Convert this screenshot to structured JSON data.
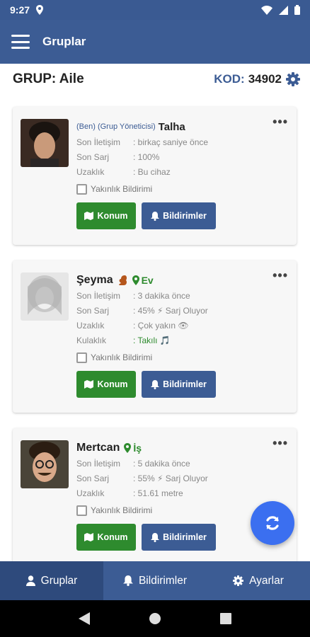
{
  "status_bar": {
    "time": "9:27"
  },
  "app_bar": {
    "title": "Gruplar"
  },
  "group": {
    "name": "GRUP: Aile",
    "code_label": "KOD:",
    "code_value": "34902"
  },
  "labels": {
    "last_contact": "Son İletişim",
    "last_charge": "Son Sarj",
    "distance": "Uzaklık",
    "headphones": "Kulaklık",
    "proximity": "Yakınlık Bildirimi",
    "location_btn": "Konum",
    "notifications_btn": "Bildirimler",
    "more": "•••"
  },
  "members": [
    {
      "tag": "(Ben) (Grup Yöneticisi)",
      "name": "Talha",
      "last_contact": ": birkaç saniye önce",
      "charge": ": 100%",
      "distance": ": Bu cihaz"
    },
    {
      "name": "Şeyma",
      "place": "Ev",
      "last_contact": ": 3 dakika önce",
      "charge": ": 45% ⚡ Sarj Oluyor",
      "distance": ": Çok yakın 👁",
      "headphones": ": Takılı 🎵"
    },
    {
      "name": "Mertcan",
      "place": "İş",
      "last_contact": ": 5 dakika önce",
      "charge": ": 55% ⚡ Sarj Oluyor",
      "distance": ": 51.61 metre"
    }
  ],
  "bottom_nav": [
    {
      "label": "Gruplar",
      "icon": "user-icon",
      "active": true
    },
    {
      "label": "Bildirimler",
      "icon": "bell-icon",
      "active": false
    },
    {
      "label": "Ayarlar",
      "icon": "gear-icon",
      "active": false
    }
  ],
  "colors": {
    "primary": "#3c5c94",
    "green": "#2e8b2e",
    "fab": "#3b6ff0"
  }
}
